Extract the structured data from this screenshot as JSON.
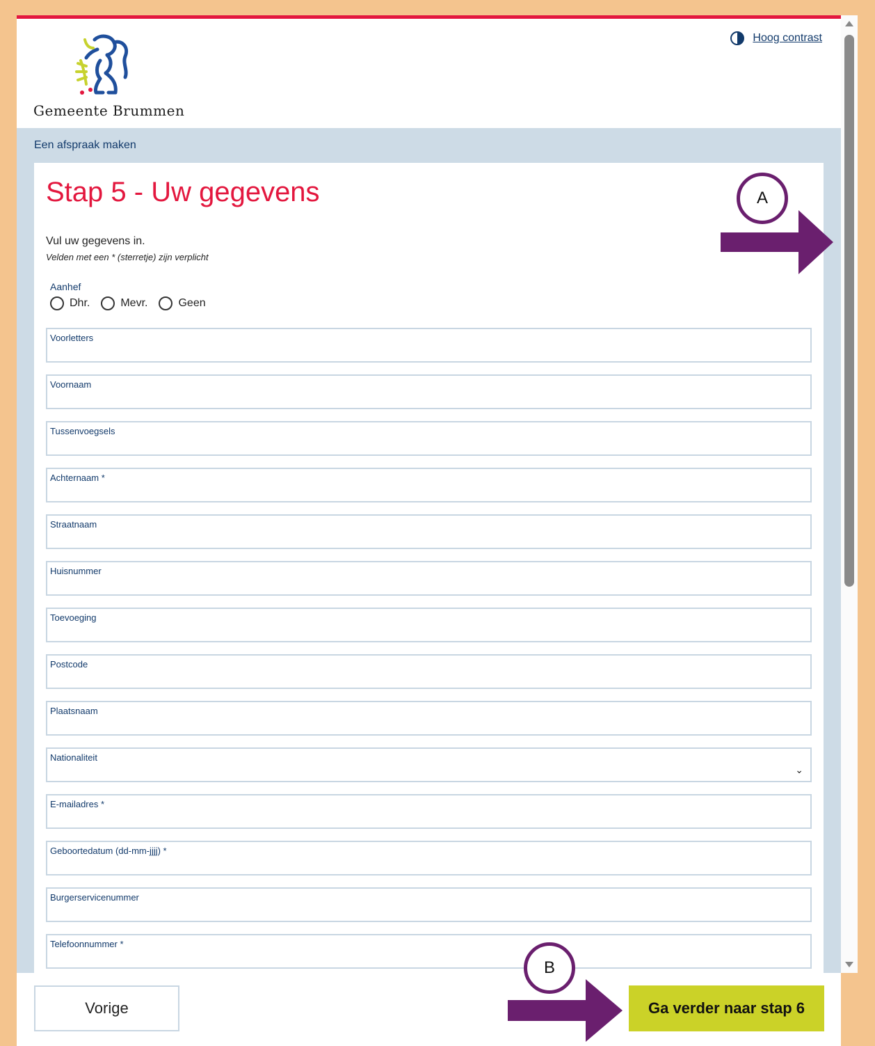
{
  "header": {
    "logo_text": "Gemeente Brummen",
    "contrast_label": "Hoog contrast"
  },
  "breadcrumb": "Een afspraak maken",
  "form": {
    "title": "Stap 5 - Uw gegevens",
    "intro": "Vul uw gegevens in.",
    "note": "Velden met een * (sterretje) zijn verplicht",
    "aanhef_label": "Aanhef",
    "aanhef_options": [
      "Dhr.",
      "Mevr.",
      "Geen"
    ],
    "fields": [
      {
        "label": "Voorletters"
      },
      {
        "label": "Voornaam"
      },
      {
        "label": "Tussenvoegsels"
      },
      {
        "label": "Achternaam *"
      },
      {
        "label": "Straatnaam"
      },
      {
        "label": "Huisnummer"
      },
      {
        "label": "Toevoeging"
      },
      {
        "label": "Postcode"
      },
      {
        "label": "Plaatsnaam"
      },
      {
        "label": "Nationaliteit"
      },
      {
        "label": "E-mailadres *"
      },
      {
        "label": "Geboortedatum (dd-mm-jjjj) *"
      },
      {
        "label": "Burgerservicenummer"
      },
      {
        "label": "Telefoonnummer *"
      }
    ]
  },
  "footer": {
    "prev_label": "Vorige",
    "next_label": "Ga verder naar stap 6"
  },
  "annotations": {
    "a": "A",
    "b": "B"
  },
  "colors": {
    "accent_red": "#e3173e",
    "navy": "#123a6b",
    "band": "#cddbe6",
    "next_button": "#cbd228",
    "annotation_purple": "#6a1f6e",
    "page_border": "#f4c48e"
  }
}
